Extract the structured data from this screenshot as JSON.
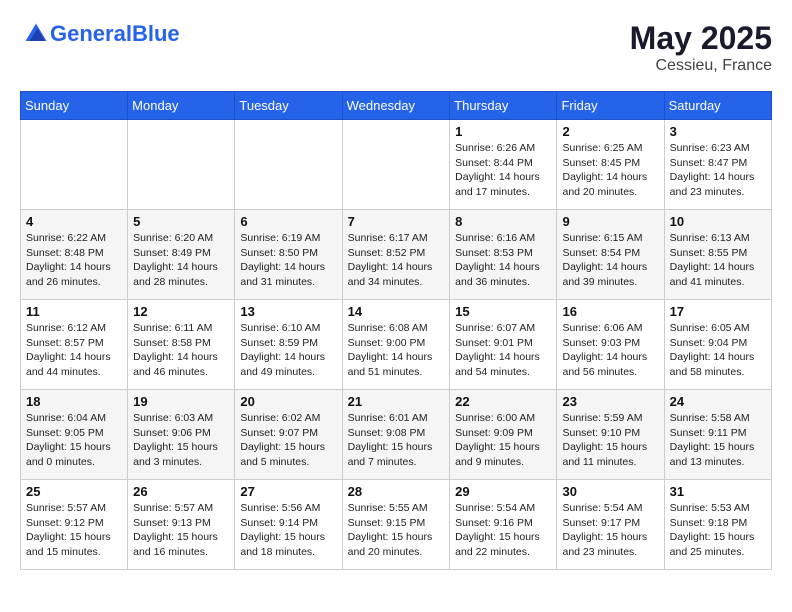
{
  "header": {
    "logo_general": "General",
    "logo_blue": "Blue",
    "month_year": "May 2025",
    "location": "Cessieu, France"
  },
  "days_of_week": [
    "Sunday",
    "Monday",
    "Tuesday",
    "Wednesday",
    "Thursday",
    "Friday",
    "Saturday"
  ],
  "weeks": [
    [
      {
        "day": "",
        "info": ""
      },
      {
        "day": "",
        "info": ""
      },
      {
        "day": "",
        "info": ""
      },
      {
        "day": "",
        "info": ""
      },
      {
        "day": "1",
        "info": "Sunrise: 6:26 AM\nSunset: 8:44 PM\nDaylight: 14 hours\nand 17 minutes."
      },
      {
        "day": "2",
        "info": "Sunrise: 6:25 AM\nSunset: 8:45 PM\nDaylight: 14 hours\nand 20 minutes."
      },
      {
        "day": "3",
        "info": "Sunrise: 6:23 AM\nSunset: 8:47 PM\nDaylight: 14 hours\nand 23 minutes."
      }
    ],
    [
      {
        "day": "4",
        "info": "Sunrise: 6:22 AM\nSunset: 8:48 PM\nDaylight: 14 hours\nand 26 minutes."
      },
      {
        "day": "5",
        "info": "Sunrise: 6:20 AM\nSunset: 8:49 PM\nDaylight: 14 hours\nand 28 minutes."
      },
      {
        "day": "6",
        "info": "Sunrise: 6:19 AM\nSunset: 8:50 PM\nDaylight: 14 hours\nand 31 minutes."
      },
      {
        "day": "7",
        "info": "Sunrise: 6:17 AM\nSunset: 8:52 PM\nDaylight: 14 hours\nand 34 minutes."
      },
      {
        "day": "8",
        "info": "Sunrise: 6:16 AM\nSunset: 8:53 PM\nDaylight: 14 hours\nand 36 minutes."
      },
      {
        "day": "9",
        "info": "Sunrise: 6:15 AM\nSunset: 8:54 PM\nDaylight: 14 hours\nand 39 minutes."
      },
      {
        "day": "10",
        "info": "Sunrise: 6:13 AM\nSunset: 8:55 PM\nDaylight: 14 hours\nand 41 minutes."
      }
    ],
    [
      {
        "day": "11",
        "info": "Sunrise: 6:12 AM\nSunset: 8:57 PM\nDaylight: 14 hours\nand 44 minutes."
      },
      {
        "day": "12",
        "info": "Sunrise: 6:11 AM\nSunset: 8:58 PM\nDaylight: 14 hours\nand 46 minutes."
      },
      {
        "day": "13",
        "info": "Sunrise: 6:10 AM\nSunset: 8:59 PM\nDaylight: 14 hours\nand 49 minutes."
      },
      {
        "day": "14",
        "info": "Sunrise: 6:08 AM\nSunset: 9:00 PM\nDaylight: 14 hours\nand 51 minutes."
      },
      {
        "day": "15",
        "info": "Sunrise: 6:07 AM\nSunset: 9:01 PM\nDaylight: 14 hours\nand 54 minutes."
      },
      {
        "day": "16",
        "info": "Sunrise: 6:06 AM\nSunset: 9:03 PM\nDaylight: 14 hours\nand 56 minutes."
      },
      {
        "day": "17",
        "info": "Sunrise: 6:05 AM\nSunset: 9:04 PM\nDaylight: 14 hours\nand 58 minutes."
      }
    ],
    [
      {
        "day": "18",
        "info": "Sunrise: 6:04 AM\nSunset: 9:05 PM\nDaylight: 15 hours\nand 0 minutes."
      },
      {
        "day": "19",
        "info": "Sunrise: 6:03 AM\nSunset: 9:06 PM\nDaylight: 15 hours\nand 3 minutes."
      },
      {
        "day": "20",
        "info": "Sunrise: 6:02 AM\nSunset: 9:07 PM\nDaylight: 15 hours\nand 5 minutes."
      },
      {
        "day": "21",
        "info": "Sunrise: 6:01 AM\nSunset: 9:08 PM\nDaylight: 15 hours\nand 7 minutes."
      },
      {
        "day": "22",
        "info": "Sunrise: 6:00 AM\nSunset: 9:09 PM\nDaylight: 15 hours\nand 9 minutes."
      },
      {
        "day": "23",
        "info": "Sunrise: 5:59 AM\nSunset: 9:10 PM\nDaylight: 15 hours\nand 11 minutes."
      },
      {
        "day": "24",
        "info": "Sunrise: 5:58 AM\nSunset: 9:11 PM\nDaylight: 15 hours\nand 13 minutes."
      }
    ],
    [
      {
        "day": "25",
        "info": "Sunrise: 5:57 AM\nSunset: 9:12 PM\nDaylight: 15 hours\nand 15 minutes."
      },
      {
        "day": "26",
        "info": "Sunrise: 5:57 AM\nSunset: 9:13 PM\nDaylight: 15 hours\nand 16 minutes."
      },
      {
        "day": "27",
        "info": "Sunrise: 5:56 AM\nSunset: 9:14 PM\nDaylight: 15 hours\nand 18 minutes."
      },
      {
        "day": "28",
        "info": "Sunrise: 5:55 AM\nSunset: 9:15 PM\nDaylight: 15 hours\nand 20 minutes."
      },
      {
        "day": "29",
        "info": "Sunrise: 5:54 AM\nSunset: 9:16 PM\nDaylight: 15 hours\nand 22 minutes."
      },
      {
        "day": "30",
        "info": "Sunrise: 5:54 AM\nSunset: 9:17 PM\nDaylight: 15 hours\nand 23 minutes."
      },
      {
        "day": "31",
        "info": "Sunrise: 5:53 AM\nSunset: 9:18 PM\nDaylight: 15 hours\nand 25 minutes."
      }
    ]
  ]
}
